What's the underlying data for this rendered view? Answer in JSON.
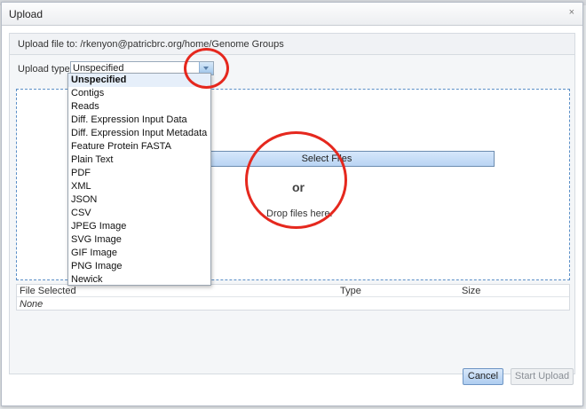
{
  "dialog": {
    "title": "Upload",
    "close_glyph": "×",
    "upload_to": "Upload file to: /rkenyon@patricbrc.org/home/Genome Groups"
  },
  "upload_type": {
    "label": "Upload type:",
    "selected": "Unspecified",
    "options": [
      "Unspecified",
      "Contigs",
      "Reads",
      "Diff. Expression Input Data",
      "Diff. Expression Input Metadata",
      "Feature Protein FASTA",
      "Plain Text",
      "PDF",
      "XML",
      "JSON",
      "CSV",
      "JPEG Image",
      "SVG Image",
      "GIF Image",
      "PNG Image",
      "Newick"
    ]
  },
  "dropzone": {
    "select_files": "Select Files",
    "or": "or",
    "drop_hint": "Drop files here."
  },
  "files_table": {
    "columns": [
      "File Selected",
      "Type",
      "Size"
    ],
    "empty_text": "None"
  },
  "buttons": {
    "cancel": "Cancel",
    "start_upload": "Start Upload"
  },
  "colors": {
    "annotation_circle": "#e5281e",
    "dashed_border": "#5b8fc7"
  }
}
